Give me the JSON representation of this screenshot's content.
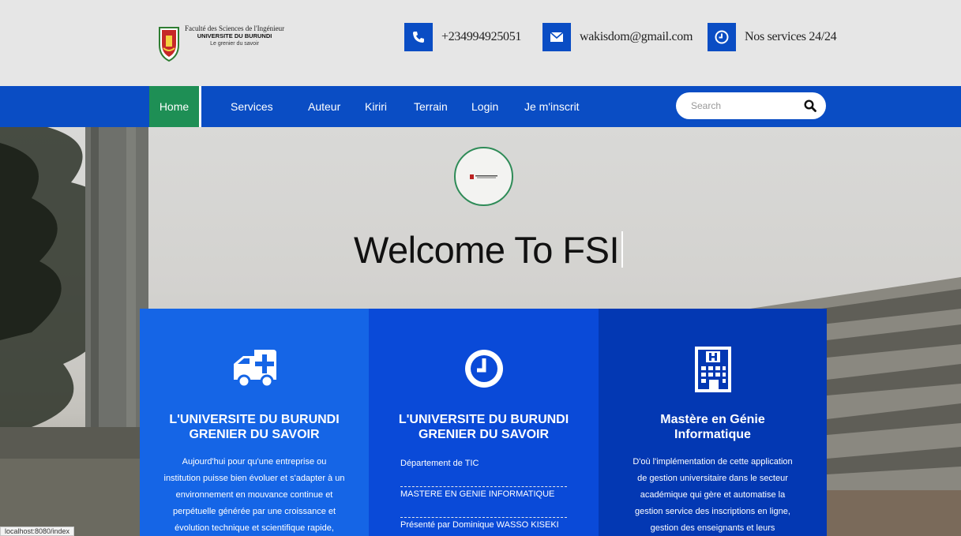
{
  "header": {
    "logo": {
      "faculty": "Faculté des Sciences de l'Ingénieur",
      "university": "UNIVERSITE DU BURUNDI",
      "motto": "Le grenier du savoir"
    },
    "phone": {
      "icon": "phone-icon",
      "text": "+234994925051"
    },
    "email": {
      "icon": "envelope-icon",
      "text": "wakisdom@gmail.com"
    },
    "hours": {
      "icon": "clock-icon",
      "text": "Nos services 24/24"
    }
  },
  "nav": {
    "items": [
      "Home",
      "Services",
      "Auteur",
      "Kiriri",
      "Terrain",
      "Login",
      "Je m'inscrit"
    ],
    "active": "Home",
    "search_placeholder": "Search"
  },
  "hero": {
    "title": "Welcome To FSI"
  },
  "cards": [
    {
      "icon": "ambulance-icon",
      "title_line1": "L'UNIVERSITE DU BURUNDI",
      "title_line2": "GRENIER DU SAVOIR",
      "body": "Aujourd'hui pour qu'une entreprise ou institution puisse bien évoluer et s'adapter à un environnement en mouvance continue et perpétuelle générée par une croissance et évolution technique et scientifique rapide,"
    },
    {
      "icon": "clock-icon",
      "title_line1": "L'UNIVERSITE DU BURUNDI",
      "title_line2": "GRENIER DU SAVOIR",
      "list": [
        "Département de TIC",
        "MASTERE EN GENIE INFORMATIQUE",
        "Présenté par Dominique WASSO KISEKI"
      ]
    },
    {
      "icon": "hospital-building-icon",
      "title_line1": "Mastère en Génie",
      "title_line2": "Informatique",
      "body": "D'où l'implémentation de cette application de gestion universitaire dans le secteur académique qui gère et automatise la gestion service des inscriptions en ligne, gestion des enseignants et leurs"
    }
  ],
  "status_bar": "localhost:8080/index",
  "colors": {
    "primary": "#0a4dc4",
    "active_nav": "#1e8f55",
    "card1": "#1565e6",
    "card2": "#0a4ad8",
    "card3": "#0338b3"
  }
}
